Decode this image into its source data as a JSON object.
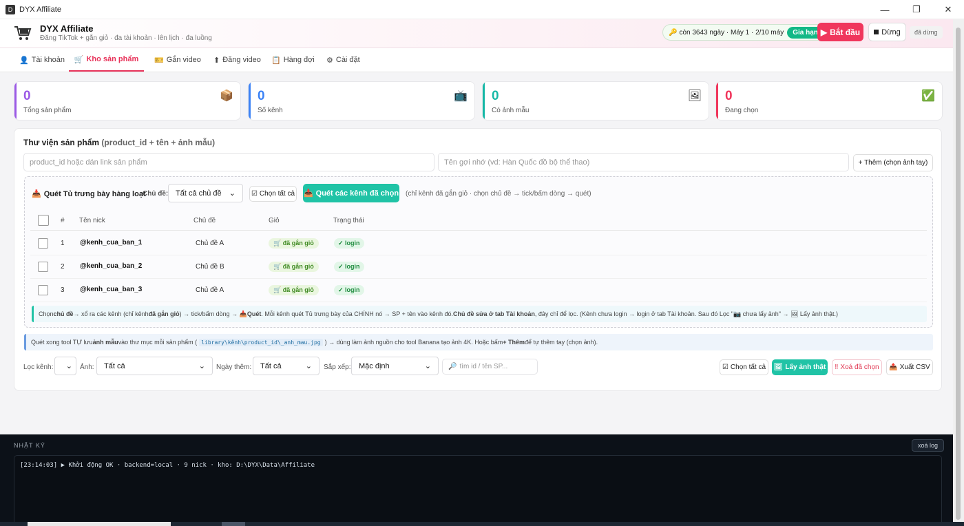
{
  "window": {
    "title": "DYX Affiliate",
    "controls": [
      "minimize-icon",
      "maximize-icon",
      "close-icon"
    ]
  },
  "header": {
    "brand": "DYX Affiliate",
    "tagline": "Đăng TikTok + gắn giỏ · đa tài khoản · lên lịch · đa luồng",
    "license_text": "còn 3643 ngày · Máy 1 · 2/10 máy",
    "renew_label": "Gia hạn",
    "start_label": "Bắt đầu",
    "stop_label": "Dừng",
    "status": "đã dừng"
  },
  "tabs": [
    {
      "icon": "👤",
      "label": "Tài khoản"
    },
    {
      "icon": "🛒",
      "label": "Kho sản phẩm"
    },
    {
      "icon": "🎫",
      "label": "Gắn video"
    },
    {
      "icon": "⬆",
      "label": "Đăng video"
    },
    {
      "icon": "📋",
      "label": "Hàng đợi"
    },
    {
      "icon": "⚙",
      "label": "Cài đặt"
    }
  ],
  "active_tab": "Kho sản phẩm",
  "stats": [
    {
      "value": "0",
      "label": "Tổng sản phẩm",
      "color": "#9b59e6",
      "icon": "📦"
    },
    {
      "value": "0",
      "label": "Số kênh",
      "color": "#3b82f6",
      "icon": "📺"
    },
    {
      "value": "0",
      "label": "Có ảnh mẫu",
      "color": "#14b8a6",
      "icon": "🖼"
    },
    {
      "value": "0",
      "label": "Đang chọn",
      "color": "#f0365c",
      "icon": "✅"
    }
  ],
  "library": {
    "title": "Thư viện sản phẩm",
    "subtitle": "(product_id + tên + ảnh mẫu)",
    "product_placeholder": "product_id hoặc dán link sản phẩm",
    "name_placeholder": "Tên gợi nhớ (vd: Hàn Quốc đồ bộ thể thao)",
    "add_label": "+ Thêm (chọn ảnh tay)"
  },
  "scan": {
    "title": "Quét Tủ trưng bày hàng loạt",
    "topic_label": "Chủ đề:",
    "topic_value": "Tất cả chủ đề",
    "select_all": "Chọn tất cả",
    "scan_button": "Quét các kênh đã chọn",
    "hint": "(chỉ kênh đã gắn giỏ · chọn chủ đề → tick/bấm dòng → quét)",
    "columns": [
      "#",
      "Tên nick",
      "Chủ đề",
      "Giỏ",
      "Trạng thái"
    ],
    "rows": [
      {
        "index": "1",
        "nick": "@kenh_cua_ban_1",
        "topic": "Chủ đề A",
        "cart": "🛒 đã gắn giỏ",
        "status": "✓ login"
      },
      {
        "index": "2",
        "nick": "@kenh_cua_ban_2",
        "topic": "Chủ đề B",
        "cart": "🛒 đã gắn giỏ",
        "status": "✓ login"
      },
      {
        "index": "3",
        "nick": "@kenh_cua_ban_3",
        "topic": "Chủ đề A",
        "cart": "🛒 đã gắn giỏ",
        "status": "✓ login"
      }
    ],
    "note": {
      "t1": "Chọn ",
      "b1": "chủ đề",
      "t2": " → xổ ra các kênh (chỉ kênh ",
      "b2": "đã gắn giỏ",
      "t3": ") → tick/bấm dòng → 📥 ",
      "b3": "Quét",
      "t4": ". Mỗi kênh quét Tủ trưng bày của CHÍNH nó → SP + tên vào kênh đó. ",
      "b4": "Chủ đề sửa ở tab Tài khoản",
      "t5": ", đây chỉ để lọc. (Kênh chưa login → login ở tab Tài khoản. Sau đó Lọc \"📷 chưa lấy ảnh\" → 🖼 Lấy ảnh thật.)"
    }
  },
  "info": {
    "t1": "Quét xong tool TỰ lưu ",
    "b1": "ảnh mẫu",
    "t2": " vào thư mục mỗi sản phẩm (",
    "code": "library\\kênh\\product_id\\_anh_mau.jpg",
    "t3": ") → dùng làm ảnh nguồn cho tool Banana tạo ảnh 4K. Hoặc bấm ",
    "b2": "+ Thêm",
    "t4": " để tự thêm tay (chọn ảnh)."
  },
  "filters": {
    "channel_label": "Lọc kênh:",
    "channel_value": "",
    "image_label": "Ảnh:",
    "image_value": "Tất cả",
    "date_label": "Ngày thêm:",
    "date_value": "Tất cả",
    "sort_label": "Sắp xếp:",
    "sort_value": "Mặc định",
    "search_placeholder": "tìm id / tên SP...",
    "select_all": "Chọn tất cả",
    "get_images": "Lấy ảnh thật",
    "delete_selected": "Xoá đã chọn",
    "export_csv": "Xuất CSV"
  },
  "log": {
    "title": "NHẬT KÝ",
    "clear_label": "xoá log",
    "lines": [
      "[23:14:03] ▶ Khởi động OK · backend=local · 9 nick · kho: D:\\DYX\\Data\\Affiliate"
    ]
  }
}
